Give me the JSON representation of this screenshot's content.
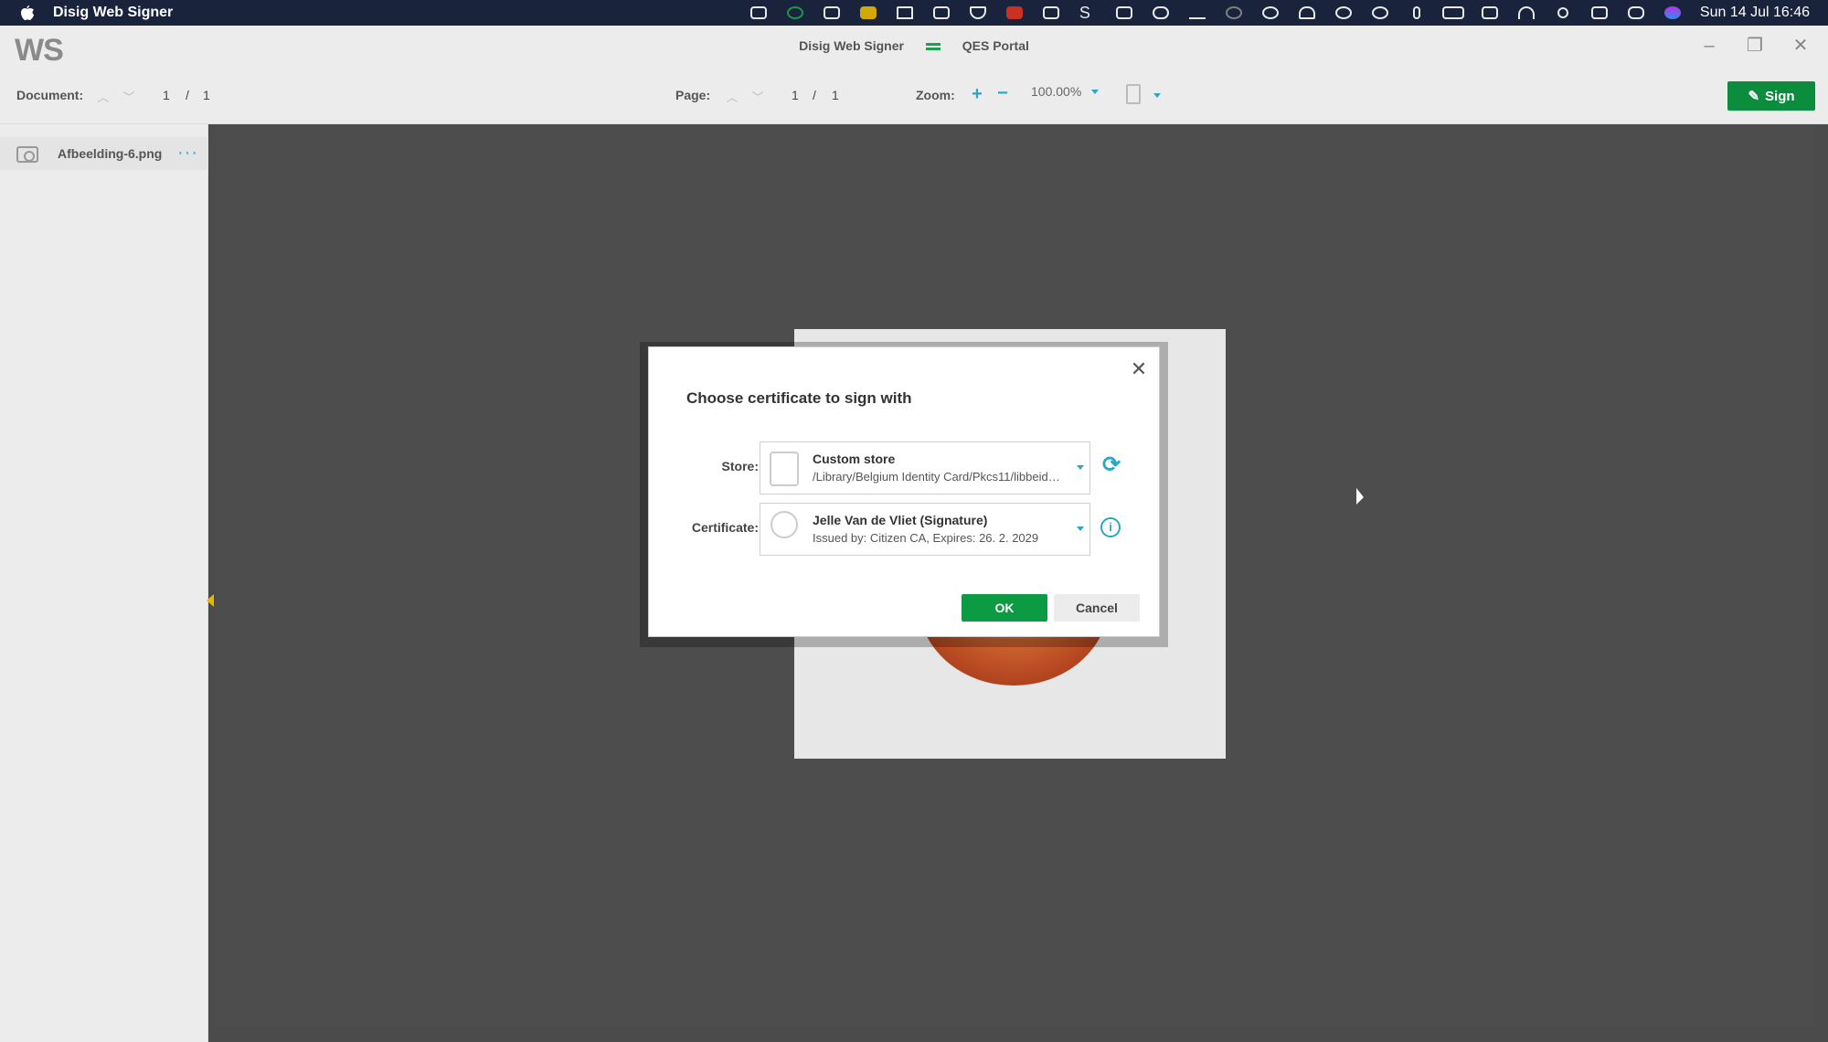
{
  "menubar": {
    "app_name": "Disig Web Signer",
    "clock": "Sun 14 Jul  16:46",
    "status_icons": [
      "creative-cloud-icon",
      "dollar-icon",
      "box-icon",
      "ws-icon",
      "vlc-icon",
      "tag-icon",
      "shield-icon",
      "pdf-icon",
      "download-icon",
      "s-icon",
      "widgets-icon",
      "cloud-icon",
      "signature-icon",
      "moon-icon",
      "play-icon",
      "headphones-icon",
      "time-machine-icon",
      "accessibility-icon",
      "bluetooth-icon",
      "battery-icon",
      "display-icon",
      "wifi-icon",
      "search-icon",
      "keyboard-icon",
      "control-center-icon",
      "siri-icon"
    ]
  },
  "window": {
    "logo": "WS",
    "title_left": "Disig Web Signer",
    "title_right": "QES Portal"
  },
  "toolbar": {
    "document_label": "Document:",
    "document_current": "1",
    "document_sep": "/",
    "document_total": "1",
    "page_label": "Page:",
    "page_current": "1",
    "page_sep": "/",
    "page_total": "1",
    "zoom_label": "Zoom:",
    "zoom_value": "100.00%",
    "sign_label": "Sign"
  },
  "sidebar": {
    "file_name": "Afbeelding-6.png"
  },
  "dialog": {
    "title": "Choose certificate to sign with",
    "store_label": "Store:",
    "store_name": "Custom store",
    "store_path": "/Library/Belgium Identity Card/Pkcs11/libbeid…",
    "certificate_label": "Certificate:",
    "certificate_name": "Jelle Van de Vliet (Signature)",
    "certificate_details": "Issued by: Citizen CA, Expires: 26. 2. 2029",
    "info_symbol": "i",
    "ok_label": "OK",
    "cancel_label": "Cancel"
  },
  "colors": {
    "accent_green": "#0c9a43",
    "accent_blue": "#2aa6c6",
    "menubar_bg": "#19233b"
  }
}
